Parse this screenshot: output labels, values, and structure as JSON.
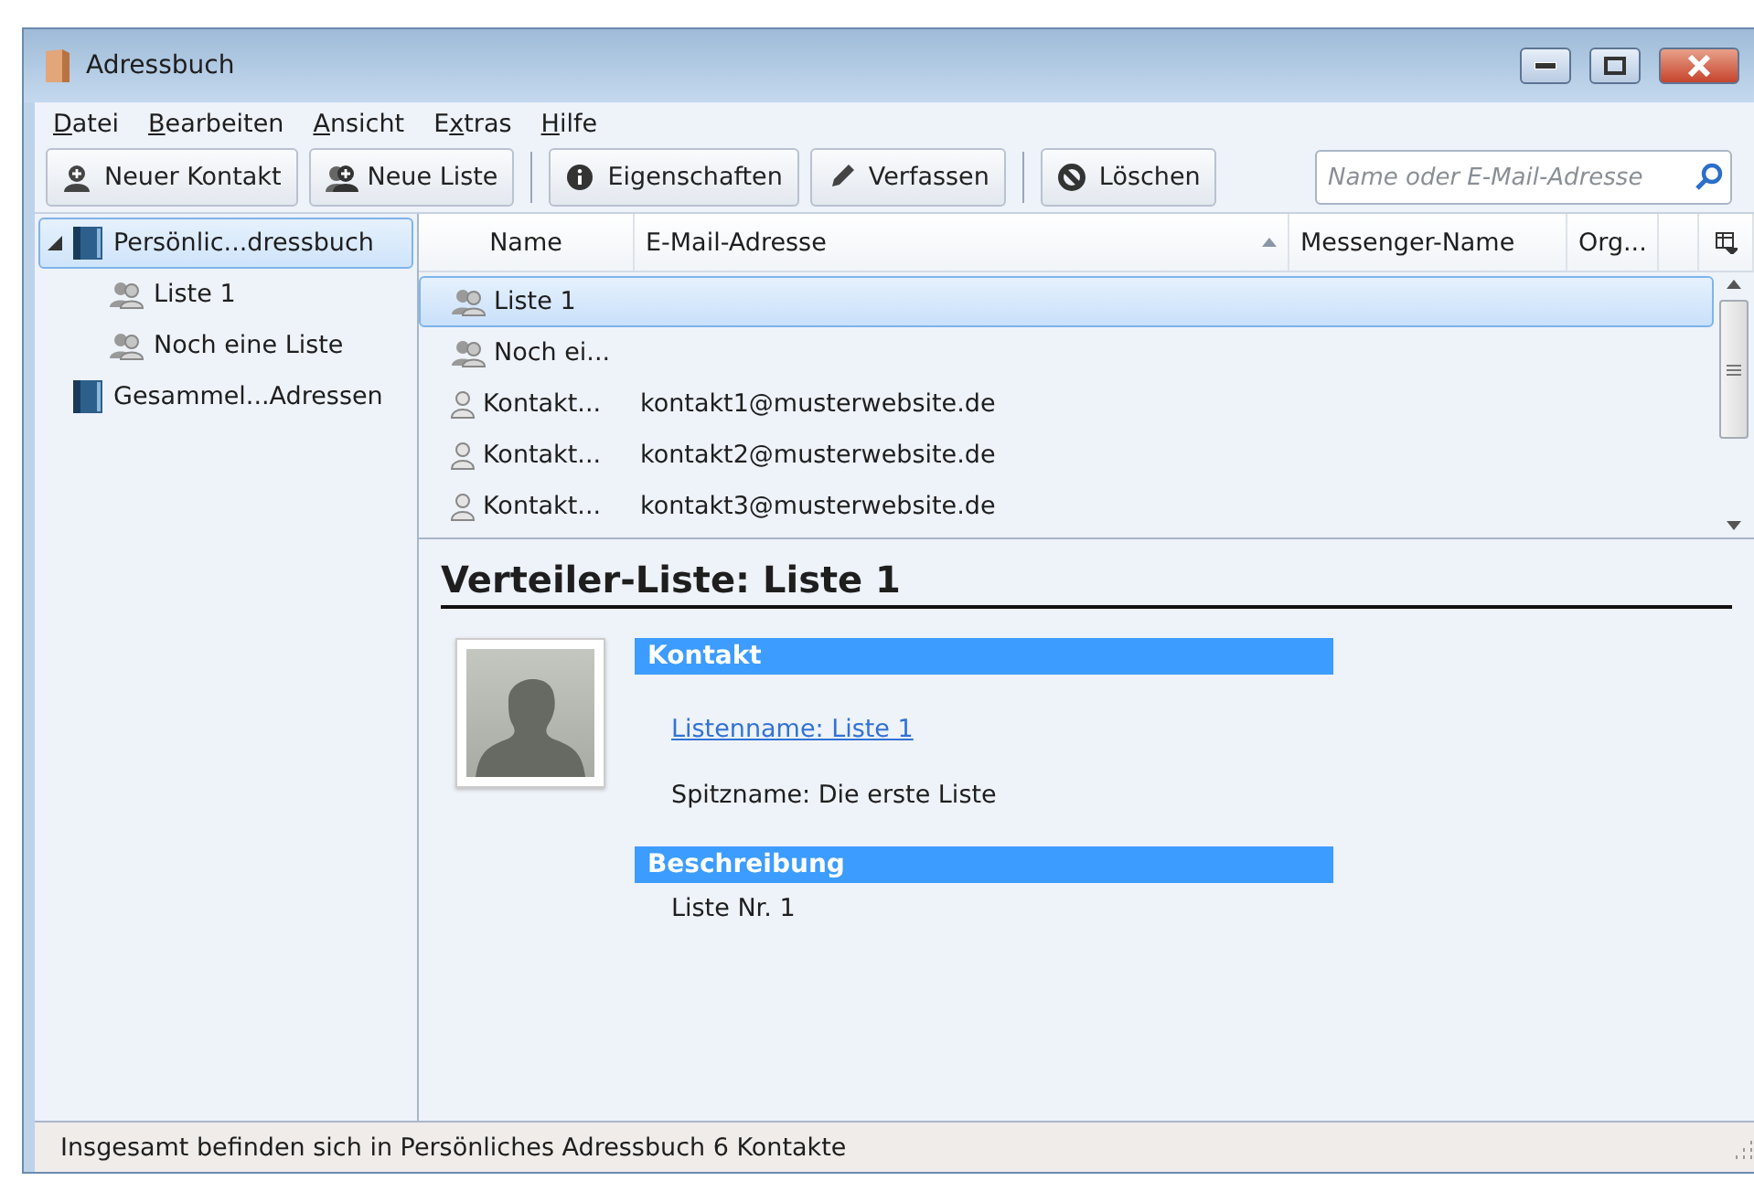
{
  "window": {
    "title": "Adressbuch"
  },
  "menu": [
    {
      "key": "D",
      "post": "atei"
    },
    {
      "key": "B",
      "post": "earbeiten"
    },
    {
      "key": "A",
      "post": "nsicht"
    },
    {
      "pre": "E",
      "key": "x",
      "post": "tras"
    },
    {
      "key": "H",
      "post": "ilfe"
    }
  ],
  "toolbar": [
    {
      "kind": "new-contact",
      "label": "Neuer Kontakt"
    },
    {
      "kind": "new-list",
      "label": "Neue Liste"
    },
    {
      "kind": "separator"
    },
    {
      "kind": "properties",
      "label": "Eigenschaften"
    },
    {
      "kind": "compose",
      "label": "Verfassen"
    },
    {
      "kind": "separator"
    },
    {
      "kind": "delete",
      "label": "Löschen"
    }
  ],
  "search": {
    "placeholder": "Name oder E-Mail-Adresse"
  },
  "sidebar": {
    "items": [
      {
        "label": "Persönlic...dressbuch",
        "kind": "book",
        "selected": true,
        "expanded": true,
        "children": [
          {
            "label": "Liste 1",
            "kind": "list",
            "selected": false
          },
          {
            "label": "Noch eine Liste",
            "kind": "list",
            "selected": false
          }
        ]
      },
      {
        "label": "Gesammel...Adressen",
        "kind": "book",
        "selected": false
      }
    ]
  },
  "table": {
    "columns": [
      {
        "label": "Name",
        "sorted": false
      },
      {
        "label": "E-Mail-Adresse",
        "sorted": true
      },
      {
        "label": "Messenger-Name",
        "sorted": false
      },
      {
        "label": "Org...",
        "sorted": false
      }
    ],
    "rows": [
      {
        "kind": "list",
        "name": "Liste 1",
        "selected": true
      },
      {
        "kind": "list",
        "name": "Noch ei...",
        "selected": false
      },
      {
        "kind": "contact",
        "name": "Kontakt...",
        "email": "kontakt1@musterwebsite.de",
        "selected": false
      },
      {
        "kind": "contact",
        "name": "Kontakt...",
        "email": "kontakt2@musterwebsite.de",
        "selected": false
      },
      {
        "kind": "contact",
        "name": "Kontakt...",
        "email": "kontakt3@musterwebsite.de",
        "selected": false
      }
    ]
  },
  "detail": {
    "title": "Verteiler-Liste: Liste 1",
    "sections": [
      {
        "heading": "Kontakt",
        "lines": [
          {
            "kind": "link",
            "text": "Listenname: Liste 1"
          },
          {
            "kind": "text",
            "text": "Spitzname: Die erste Liste"
          }
        ]
      },
      {
        "heading": "Beschreibung",
        "lines": [
          {
            "kind": "text",
            "text": "Liste Nr. 1"
          }
        ]
      }
    ]
  },
  "status_bar": {
    "text": "Insgesamt befinden sich in Persönliches Adressbuch 6 Kontakte"
  }
}
